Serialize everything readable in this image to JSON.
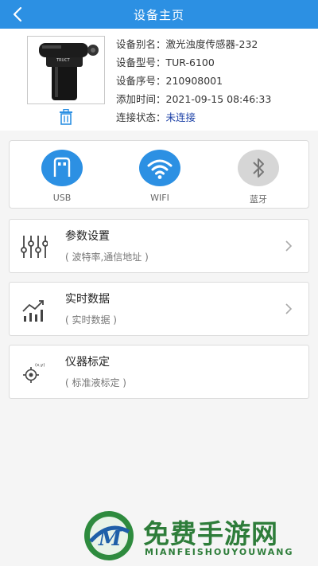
{
  "header": {
    "title": "设备主页"
  },
  "device": {
    "alias_label": "设备别名：",
    "alias_value": "激光浊度传感器-232",
    "model_label": "设备型号：",
    "model_value": "TUR-6100",
    "serial_label": "设备序号：",
    "serial_value": "210908001",
    "added_label": "添加时间：",
    "added_value": "2021-09-15 08:46:33",
    "status_label": "连接状态：",
    "status_value": "未连接",
    "brand_text": "TRUCT"
  },
  "connections": [
    {
      "label": "USB",
      "icon": "usb-icon",
      "color": "#2c90e3"
    },
    {
      "label": "WIFI",
      "icon": "wifi-icon",
      "color": "#2c90e3"
    },
    {
      "label": "蓝牙",
      "icon": "bluetooth-icon",
      "color": "#d6d6d6"
    }
  ],
  "menu": [
    {
      "title": "参数设置",
      "subtitle": "( 波特率,通信地址 )",
      "icon": "sliders-icon"
    },
    {
      "title": "实时数据",
      "subtitle": "( 实时数据 )",
      "icon": "chart-icon"
    },
    {
      "title": "仪器标定",
      "subtitle": "( 标准液标定 )",
      "icon": "target-icon",
      "icon_text": "(x,y)"
    }
  ],
  "watermark": {
    "title": "免费手游网",
    "subtitle": "MIANFEISHOUYOUWANG",
    "logo_letter": "M"
  }
}
